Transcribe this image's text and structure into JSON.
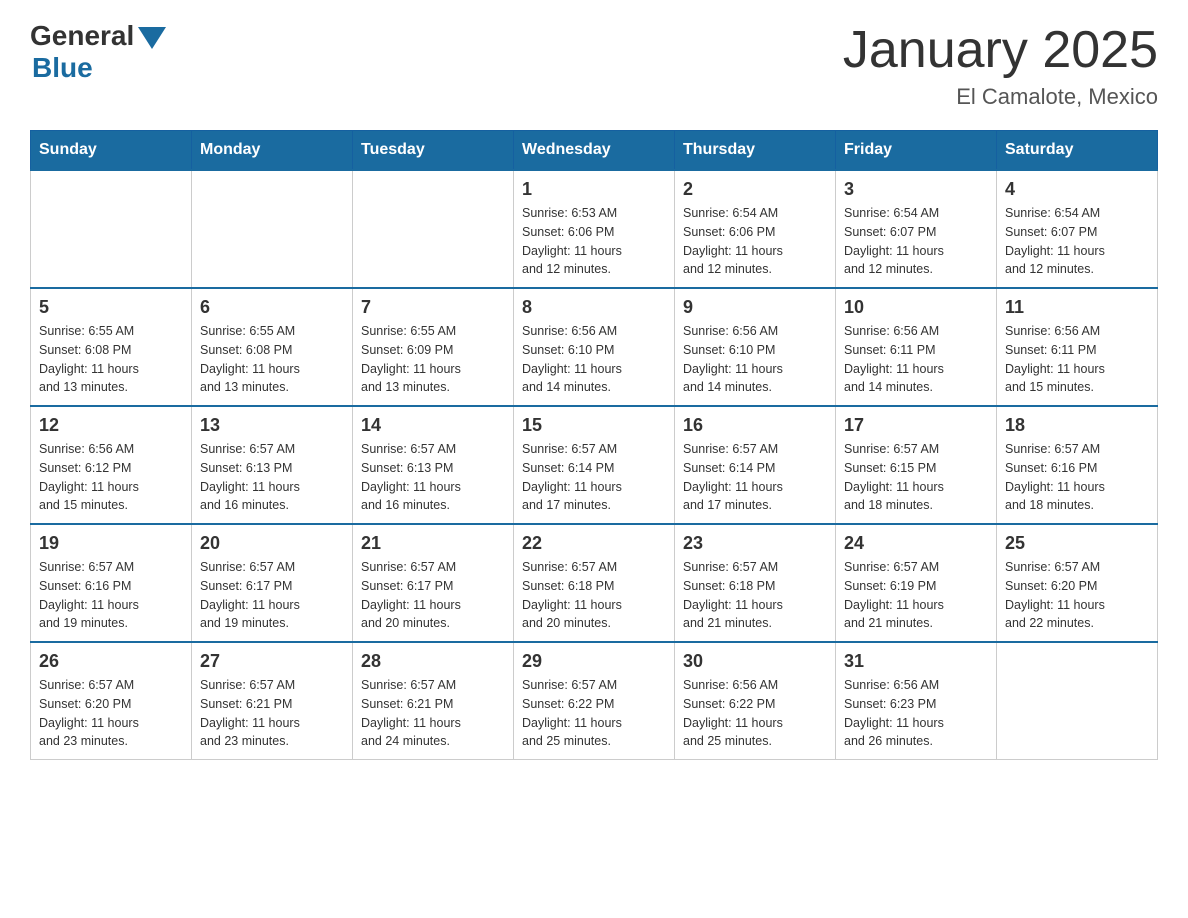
{
  "header": {
    "logo_general": "General",
    "logo_blue": "Blue",
    "title": "January 2025",
    "subtitle": "El Camalote, Mexico"
  },
  "days_of_week": [
    "Sunday",
    "Monday",
    "Tuesday",
    "Wednesday",
    "Thursday",
    "Friday",
    "Saturday"
  ],
  "weeks": [
    [
      {
        "day": "",
        "info": ""
      },
      {
        "day": "",
        "info": ""
      },
      {
        "day": "",
        "info": ""
      },
      {
        "day": "1",
        "info": "Sunrise: 6:53 AM\nSunset: 6:06 PM\nDaylight: 11 hours\nand 12 minutes."
      },
      {
        "day": "2",
        "info": "Sunrise: 6:54 AM\nSunset: 6:06 PM\nDaylight: 11 hours\nand 12 minutes."
      },
      {
        "day": "3",
        "info": "Sunrise: 6:54 AM\nSunset: 6:07 PM\nDaylight: 11 hours\nand 12 minutes."
      },
      {
        "day": "4",
        "info": "Sunrise: 6:54 AM\nSunset: 6:07 PM\nDaylight: 11 hours\nand 12 minutes."
      }
    ],
    [
      {
        "day": "5",
        "info": "Sunrise: 6:55 AM\nSunset: 6:08 PM\nDaylight: 11 hours\nand 13 minutes."
      },
      {
        "day": "6",
        "info": "Sunrise: 6:55 AM\nSunset: 6:08 PM\nDaylight: 11 hours\nand 13 minutes."
      },
      {
        "day": "7",
        "info": "Sunrise: 6:55 AM\nSunset: 6:09 PM\nDaylight: 11 hours\nand 13 minutes."
      },
      {
        "day": "8",
        "info": "Sunrise: 6:56 AM\nSunset: 6:10 PM\nDaylight: 11 hours\nand 14 minutes."
      },
      {
        "day": "9",
        "info": "Sunrise: 6:56 AM\nSunset: 6:10 PM\nDaylight: 11 hours\nand 14 minutes."
      },
      {
        "day": "10",
        "info": "Sunrise: 6:56 AM\nSunset: 6:11 PM\nDaylight: 11 hours\nand 14 minutes."
      },
      {
        "day": "11",
        "info": "Sunrise: 6:56 AM\nSunset: 6:11 PM\nDaylight: 11 hours\nand 15 minutes."
      }
    ],
    [
      {
        "day": "12",
        "info": "Sunrise: 6:56 AM\nSunset: 6:12 PM\nDaylight: 11 hours\nand 15 minutes."
      },
      {
        "day": "13",
        "info": "Sunrise: 6:57 AM\nSunset: 6:13 PM\nDaylight: 11 hours\nand 16 minutes."
      },
      {
        "day": "14",
        "info": "Sunrise: 6:57 AM\nSunset: 6:13 PM\nDaylight: 11 hours\nand 16 minutes."
      },
      {
        "day": "15",
        "info": "Sunrise: 6:57 AM\nSunset: 6:14 PM\nDaylight: 11 hours\nand 17 minutes."
      },
      {
        "day": "16",
        "info": "Sunrise: 6:57 AM\nSunset: 6:14 PM\nDaylight: 11 hours\nand 17 minutes."
      },
      {
        "day": "17",
        "info": "Sunrise: 6:57 AM\nSunset: 6:15 PM\nDaylight: 11 hours\nand 18 minutes."
      },
      {
        "day": "18",
        "info": "Sunrise: 6:57 AM\nSunset: 6:16 PM\nDaylight: 11 hours\nand 18 minutes."
      }
    ],
    [
      {
        "day": "19",
        "info": "Sunrise: 6:57 AM\nSunset: 6:16 PM\nDaylight: 11 hours\nand 19 minutes."
      },
      {
        "day": "20",
        "info": "Sunrise: 6:57 AM\nSunset: 6:17 PM\nDaylight: 11 hours\nand 19 minutes."
      },
      {
        "day": "21",
        "info": "Sunrise: 6:57 AM\nSunset: 6:17 PM\nDaylight: 11 hours\nand 20 minutes."
      },
      {
        "day": "22",
        "info": "Sunrise: 6:57 AM\nSunset: 6:18 PM\nDaylight: 11 hours\nand 20 minutes."
      },
      {
        "day": "23",
        "info": "Sunrise: 6:57 AM\nSunset: 6:18 PM\nDaylight: 11 hours\nand 21 minutes."
      },
      {
        "day": "24",
        "info": "Sunrise: 6:57 AM\nSunset: 6:19 PM\nDaylight: 11 hours\nand 21 minutes."
      },
      {
        "day": "25",
        "info": "Sunrise: 6:57 AM\nSunset: 6:20 PM\nDaylight: 11 hours\nand 22 minutes."
      }
    ],
    [
      {
        "day": "26",
        "info": "Sunrise: 6:57 AM\nSunset: 6:20 PM\nDaylight: 11 hours\nand 23 minutes."
      },
      {
        "day": "27",
        "info": "Sunrise: 6:57 AM\nSunset: 6:21 PM\nDaylight: 11 hours\nand 23 minutes."
      },
      {
        "day": "28",
        "info": "Sunrise: 6:57 AM\nSunset: 6:21 PM\nDaylight: 11 hours\nand 24 minutes."
      },
      {
        "day": "29",
        "info": "Sunrise: 6:57 AM\nSunset: 6:22 PM\nDaylight: 11 hours\nand 25 minutes."
      },
      {
        "day": "30",
        "info": "Sunrise: 6:56 AM\nSunset: 6:22 PM\nDaylight: 11 hours\nand 25 minutes."
      },
      {
        "day": "31",
        "info": "Sunrise: 6:56 AM\nSunset: 6:23 PM\nDaylight: 11 hours\nand 26 minutes."
      },
      {
        "day": "",
        "info": ""
      }
    ]
  ]
}
